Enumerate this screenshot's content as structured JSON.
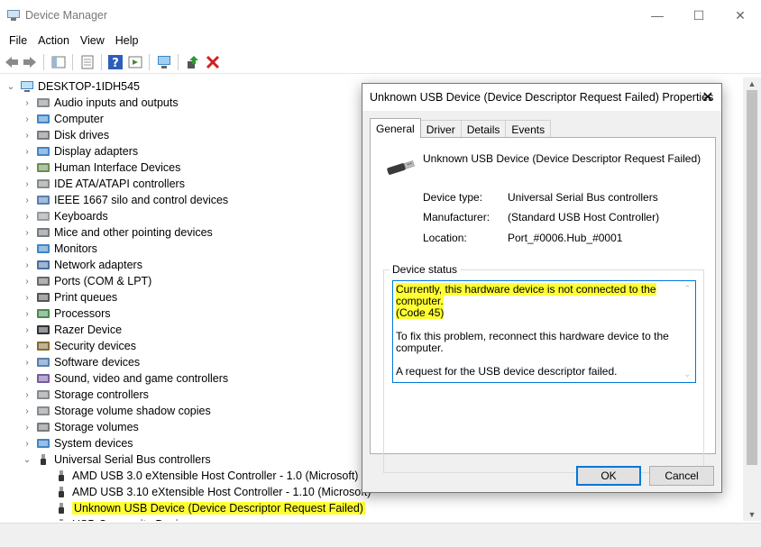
{
  "window": {
    "title": "Device Manager",
    "minimize_glyph": "—",
    "maximize_glyph": "☐",
    "close_glyph": "✕"
  },
  "menu": [
    "File",
    "Action",
    "View",
    "Help"
  ],
  "toolbar": {
    "icons": [
      "back-arrow-icon",
      "forward-arrow-icon",
      "show-hide-tree-icon",
      "properties-sheet-icon",
      "help-icon",
      "action-pane-icon",
      "monitor-scan-icon",
      "update-driver-icon",
      "uninstall-device-icon"
    ]
  },
  "tree": {
    "root": "DESKTOP-1IDH545",
    "categories": [
      "Audio inputs and outputs",
      "Computer",
      "Disk drives",
      "Display adapters",
      "Human Interface Devices",
      "IDE ATA/ATAPI controllers",
      "IEEE 1667 silo and control devices",
      "Keyboards",
      "Mice and other pointing devices",
      "Monitors",
      "Network adapters",
      "Ports (COM & LPT)",
      "Print queues",
      "Processors",
      "Razer Device",
      "Security devices",
      "Software devices",
      "Sound, video and game controllers",
      "Storage controllers",
      "Storage volume shadow copies",
      "Storage volumes",
      "System devices",
      "Universal Serial Bus controllers"
    ],
    "usb_children": [
      "AMD USB 3.0 eXtensible Host Controller - 1.0 (Microsoft)",
      "AMD USB 3.10 eXtensible Host Controller - 1.10 (Microsoft)",
      "Unknown USB Device (Device Descriptor Request Failed)",
      "USB Composite Device"
    ],
    "expand_glyph": "›",
    "collapse_glyph": "⌄"
  },
  "dialog": {
    "title": "Unknown USB Device (Device Descriptor Request Failed) Properties",
    "close_glyph": "✕",
    "tabs": [
      "General",
      "Driver",
      "Details",
      "Events"
    ],
    "active_tab": "General",
    "device_name": "Unknown USB Device (Device Descriptor Request Failed)",
    "properties": [
      {
        "label": "Device type:",
        "value": "Universal Serial Bus controllers"
      },
      {
        "label": "Manufacturer:",
        "value": "(Standard USB Host Controller)"
      },
      {
        "label": "Location:",
        "value": "Port_#0006.Hub_#0001"
      }
    ],
    "status_group_title": "Device status",
    "status_line1": "Currently, this hardware device is not connected to the computer.",
    "status_line2": "(Code 45)",
    "status_para2": "To fix this problem, reconnect this hardware device to the computer.",
    "status_para3": "A request for the USB device descriptor failed.",
    "ok_label": "OK",
    "cancel_label": "Cancel"
  },
  "colors": {
    "highlight": "#ffff33",
    "accent": "#0078d7",
    "uninstall_red": "#d21f1f"
  }
}
